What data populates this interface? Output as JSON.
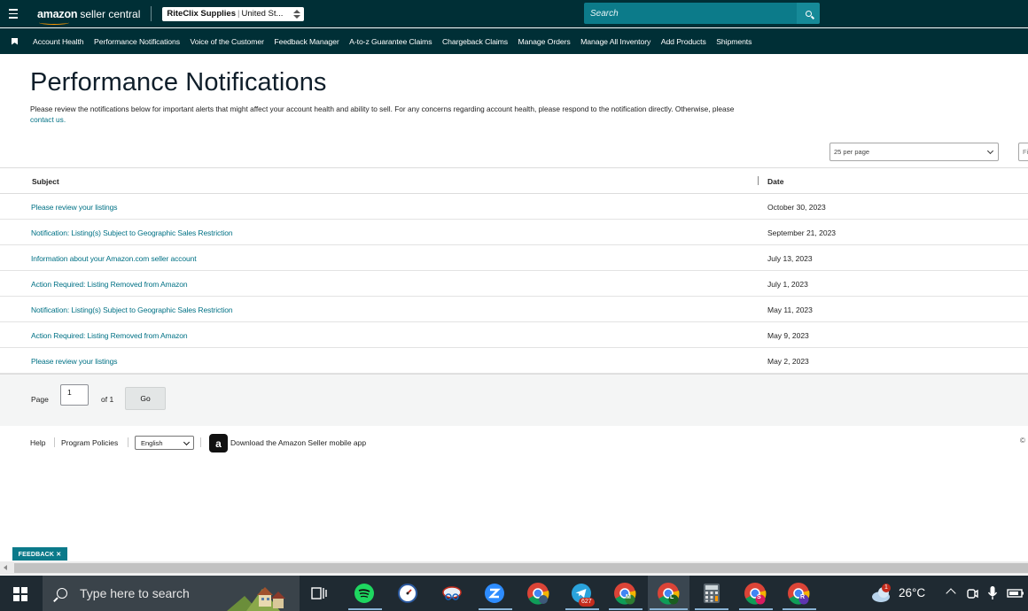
{
  "topbar": {
    "logo_amazon": "amazon",
    "logo_suffix": "seller central",
    "account_name": "RiteClix Supplies",
    "account_region": "United St...",
    "search_placeholder": "Search"
  },
  "nav": {
    "items": [
      "Account Health",
      "Performance Notifications",
      "Voice of the Customer",
      "Feedback Manager",
      "A-to-z Guarantee Claims",
      "Chargeback Claims",
      "Manage Orders",
      "Manage All Inventory",
      "Add Products",
      "Shipments"
    ]
  },
  "header": {
    "title": "Performance Notifications",
    "description": "Please review the notifications below for important alerts that might affect your account health and ability to sell. For any concerns regarding account health, please respond to the notification directly. Otherwise, please",
    "contact_link": "contact us."
  },
  "controls": {
    "per_page": "25 per page",
    "filter_stub": "Fi"
  },
  "table": {
    "columns": [
      "Subject",
      "Date"
    ],
    "rows": [
      {
        "subject": "Please review your listings",
        "date": "October 30, 2023"
      },
      {
        "subject": "Notification: Listing(s) Subject to Geographic Sales Restriction",
        "date": "September 21, 2023"
      },
      {
        "subject": "Information about your Amazon.com seller account",
        "date": "July 13, 2023"
      },
      {
        "subject": "Action Required: Listing Removed from Amazon",
        "date": "July 1, 2023"
      },
      {
        "subject": "Notification: Listing(s) Subject to Geographic Sales Restriction",
        "date": "May 11, 2023"
      },
      {
        "subject": "Action Required: Listing Removed from Amazon",
        "date": "May 9, 2023"
      },
      {
        "subject": "Please review your listings",
        "date": "May 2, 2023"
      }
    ]
  },
  "pager": {
    "page_label": "Page",
    "page_value": "1",
    "of_label": "of 1",
    "go_label": "Go"
  },
  "footer": {
    "help": "Help",
    "policies": "Program Policies",
    "language": "English",
    "app_icon_letter": "a",
    "app_link": "Download the Amazon Seller mobile app",
    "copyright": "©"
  },
  "feedback": {
    "label": "FEEDBACK ✕"
  },
  "taskbar": {
    "search_placeholder": "Type here to search",
    "telegram_badge": "627",
    "notif_badge": "1",
    "chrome_profiles": [
      "M",
      "L",
      "S",
      "R"
    ],
    "temperature": "26°C"
  },
  "colors": {
    "header_bg": "#002f36",
    "link": "#007185",
    "search_bg": "#0c7b8a",
    "accent_orange": "#ff9900"
  }
}
